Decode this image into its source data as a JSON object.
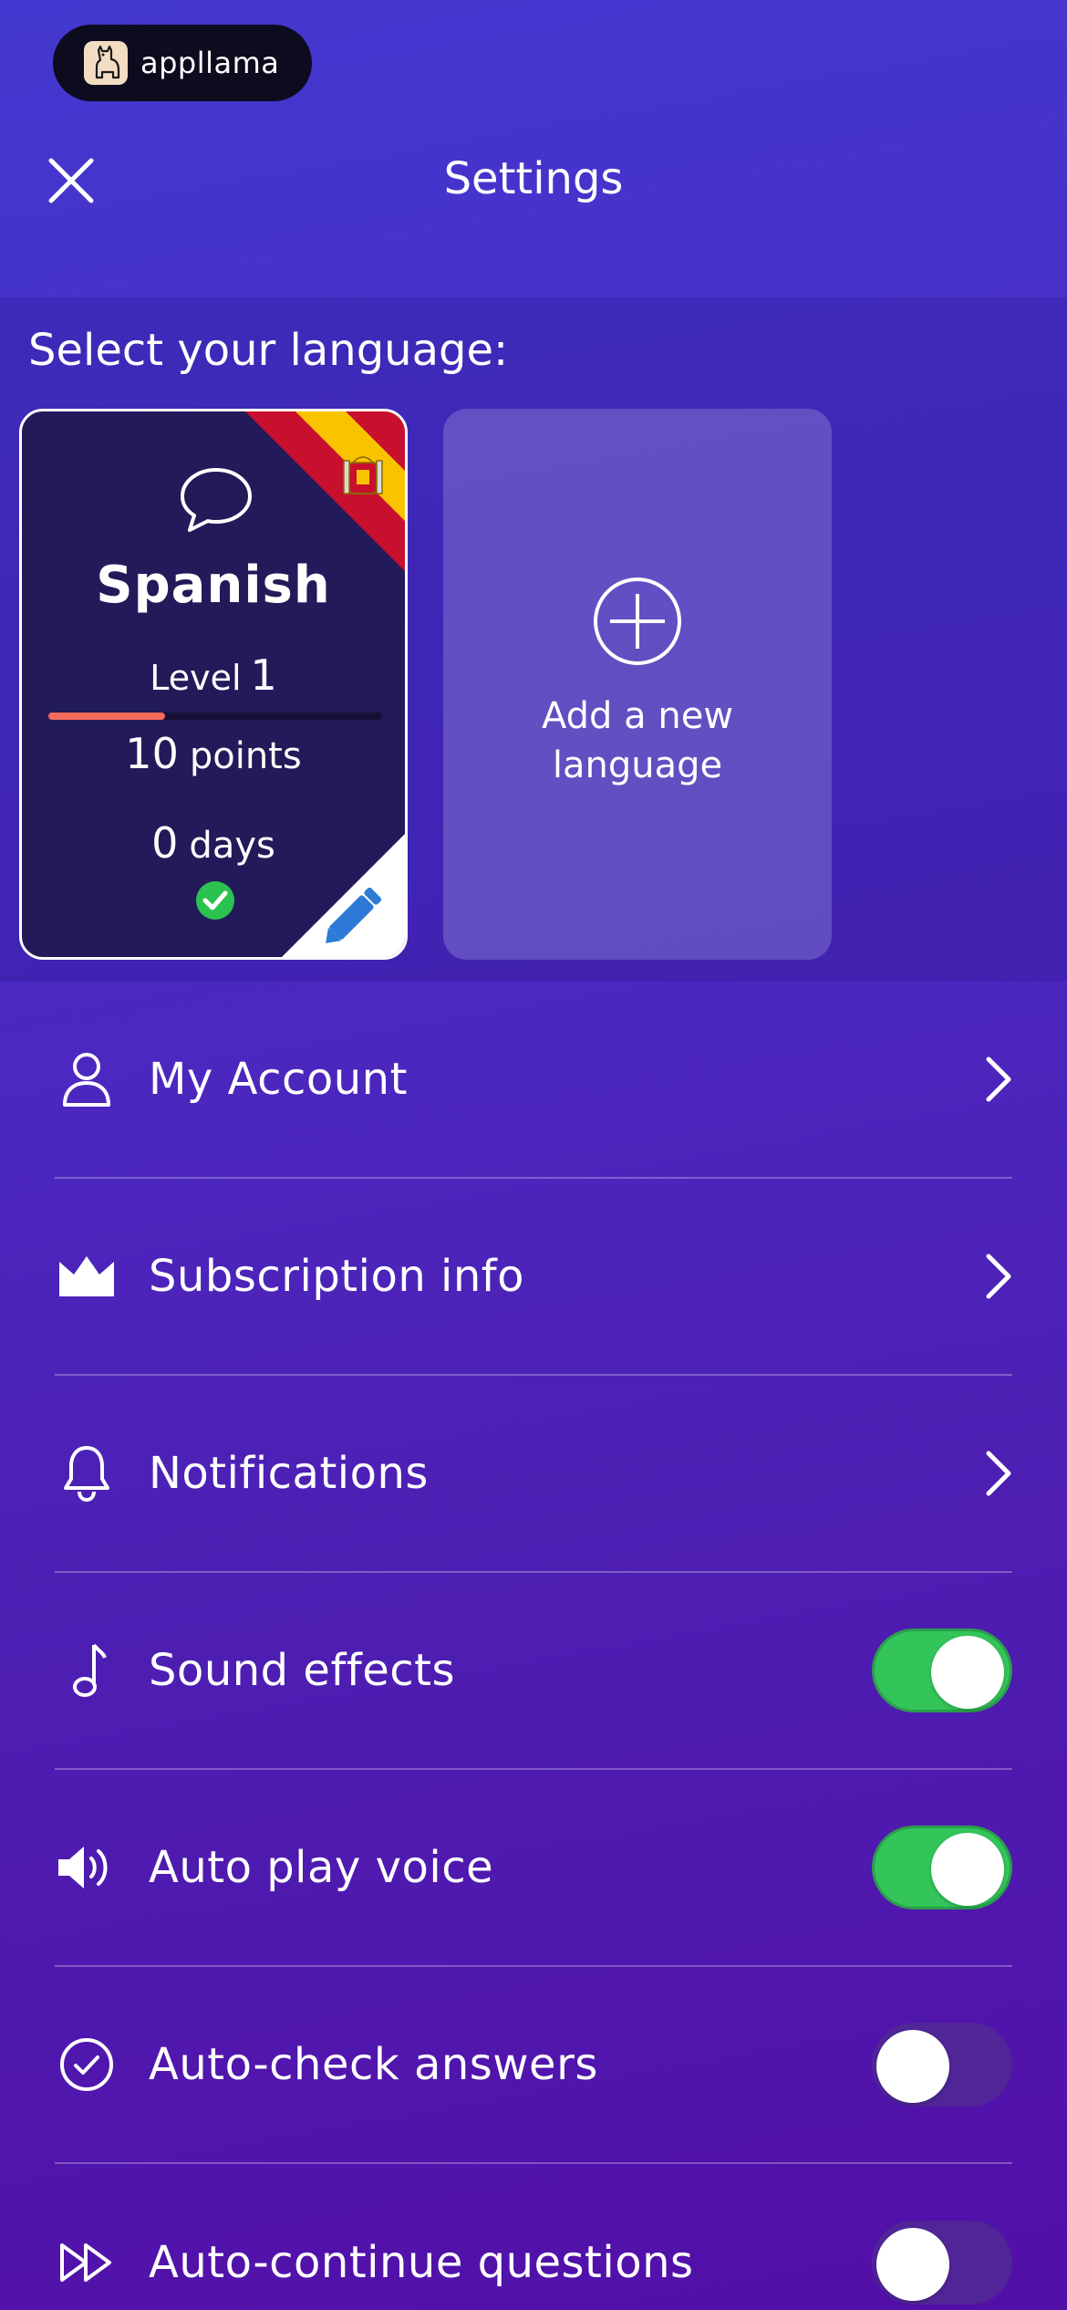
{
  "header": {
    "brand": "appllama",
    "title": "Settings"
  },
  "language_section": {
    "prompt": "Select your language:",
    "current": {
      "name": "Spanish",
      "level_label": "Level",
      "level": "1",
      "level_progress": 0.35,
      "points": "10",
      "points_label": "points",
      "days": "0",
      "days_label": "days"
    },
    "add_label": "Add a new language"
  },
  "settings": {
    "account": "My Account",
    "subscription": "Subscription info",
    "notifications": "Notifications",
    "sound_effects": "Sound effects",
    "auto_play_voice": "Auto play voice",
    "auto_check": "Auto-check answers",
    "auto_continue": "Auto-continue questions"
  },
  "toggles": {
    "sound_effects": true,
    "auto_play_voice": true,
    "auto_check": false,
    "auto_continue": false
  },
  "colors": {
    "toggle_on": "#33c45a",
    "progress": "#f26a5a",
    "card_bg": "#231a5a"
  }
}
